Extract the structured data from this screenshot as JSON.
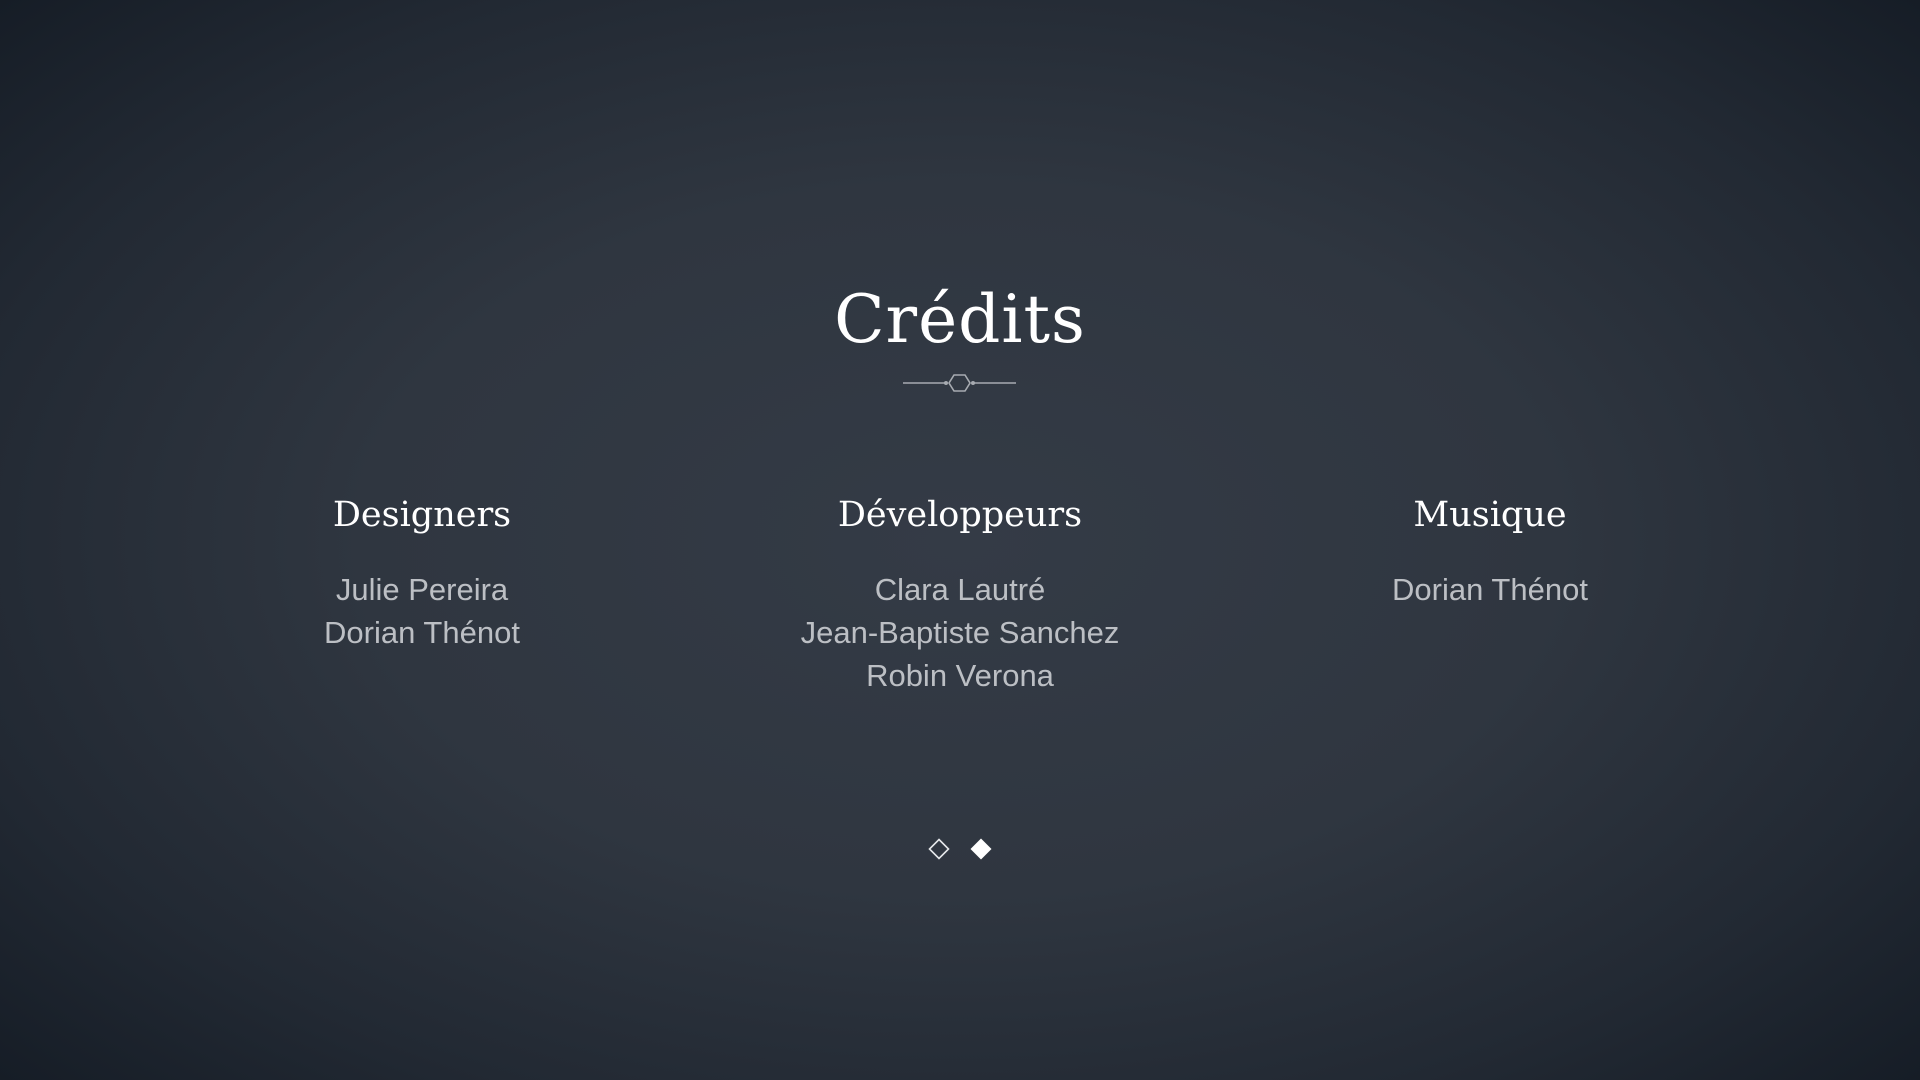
{
  "title": "Crédits",
  "sections": [
    {
      "heading": "Designers",
      "names": [
        "Julie Pereira",
        "Dorian Thénot"
      ]
    },
    {
      "heading": "Développeurs",
      "names": [
        "Clara Lautré",
        "Jean-Baptiste Sanchez",
        "Robin Verona"
      ]
    },
    {
      "heading": "Musique",
      "names": [
        "Dorian Thénot"
      ]
    }
  ],
  "pager": {
    "pages": 2,
    "active_page": 2,
    "icons": [
      "diamond-outline-icon",
      "diamond-filled-icon"
    ]
  },
  "colors": {
    "background_center": "#343b46",
    "background_edge": "#0f161f",
    "heading": "#ffffff",
    "names": "#bcbfc4",
    "ornament": "#a7abb1"
  }
}
